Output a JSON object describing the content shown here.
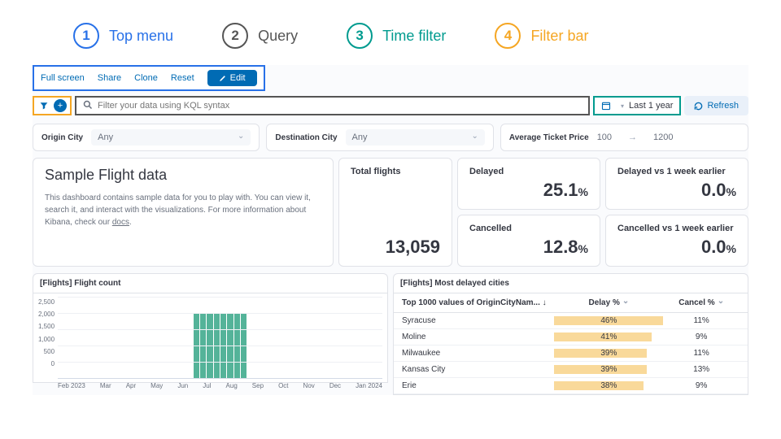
{
  "callouts": [
    {
      "n": "1",
      "label": "Top menu"
    },
    {
      "n": "2",
      "label": "Query"
    },
    {
      "n": "3",
      "label": "Time filter"
    },
    {
      "n": "4",
      "label": "Filter bar"
    }
  ],
  "topmenu": {
    "full_screen": "Full screen",
    "share": "Share",
    "clone": "Clone",
    "reset": "Reset",
    "edit": "Edit"
  },
  "query": {
    "placeholder": "Filter your data using KQL syntax"
  },
  "timefilter": {
    "label": "Last 1 year"
  },
  "refresh": "Refresh",
  "controls": {
    "origin": {
      "label": "Origin City",
      "value": "Any"
    },
    "destination": {
      "label": "Destination City",
      "value": "Any"
    },
    "price": {
      "label": "Average Ticket Price",
      "min": "100",
      "max": "1200"
    }
  },
  "intro": {
    "title": "Sample Flight data",
    "body": "This dashboard contains sample data for you to play with. You can view it, search it, and interact with the visualizations. For more information about Kibana, check our ",
    "docs": "docs"
  },
  "metrics": {
    "total_flights": {
      "title": "Total flights",
      "value": "13,059"
    },
    "delayed": {
      "title": "Delayed",
      "value": "25.1",
      "unit": "%"
    },
    "cancelled": {
      "title": "Cancelled",
      "value": "12.8",
      "unit": "%"
    },
    "delayed_vs": {
      "title": "Delayed vs 1 week earlier",
      "value": "0.0",
      "unit": "%"
    },
    "cancelled_vs": {
      "title": "Cancelled vs 1 week earlier",
      "value": "0.0",
      "unit": "%"
    }
  },
  "flight_count": {
    "title": "[Flights] Flight count"
  },
  "delayed_cities": {
    "title": "[Flights] Most delayed cities",
    "col1": "Top 1000 values of OriginCityNam...",
    "col2": "Delay %",
    "col3": "Cancel %",
    "rows": [
      {
        "city": "Syracuse",
        "delay": "46%",
        "cancel": "11%",
        "heat": 100
      },
      {
        "city": "Moline",
        "delay": "41%",
        "cancel": "9%",
        "heat": 89
      },
      {
        "city": "Milwaukee",
        "delay": "39%",
        "cancel": "11%",
        "heat": 85
      },
      {
        "city": "Kansas City",
        "delay": "39%",
        "cancel": "13%",
        "heat": 85
      },
      {
        "city": "Erie",
        "delay": "38%",
        "cancel": "9%",
        "heat": 82
      }
    ]
  },
  "chart_data": {
    "type": "bar",
    "title": "[Flights] Flight count",
    "ylabel": "",
    "xlabel": "",
    "ylim": [
      0,
      2500
    ],
    "yticks": [
      0,
      500,
      1000,
      1500,
      2000,
      2500
    ],
    "categories": [
      "Feb 2023",
      "Mar",
      "Apr",
      "May",
      "Jun",
      "Jul",
      "Aug",
      "Sep",
      "Oct",
      "Nov",
      "Dec",
      "Jan 2024"
    ],
    "values": [
      0,
      0,
      0,
      0,
      0,
      2000,
      2000,
      0,
      0,
      0,
      0,
      0
    ],
    "note": "Bars visible roughly mid-Jun through end-Aug at approx 2000 per bucket; other months empty."
  }
}
